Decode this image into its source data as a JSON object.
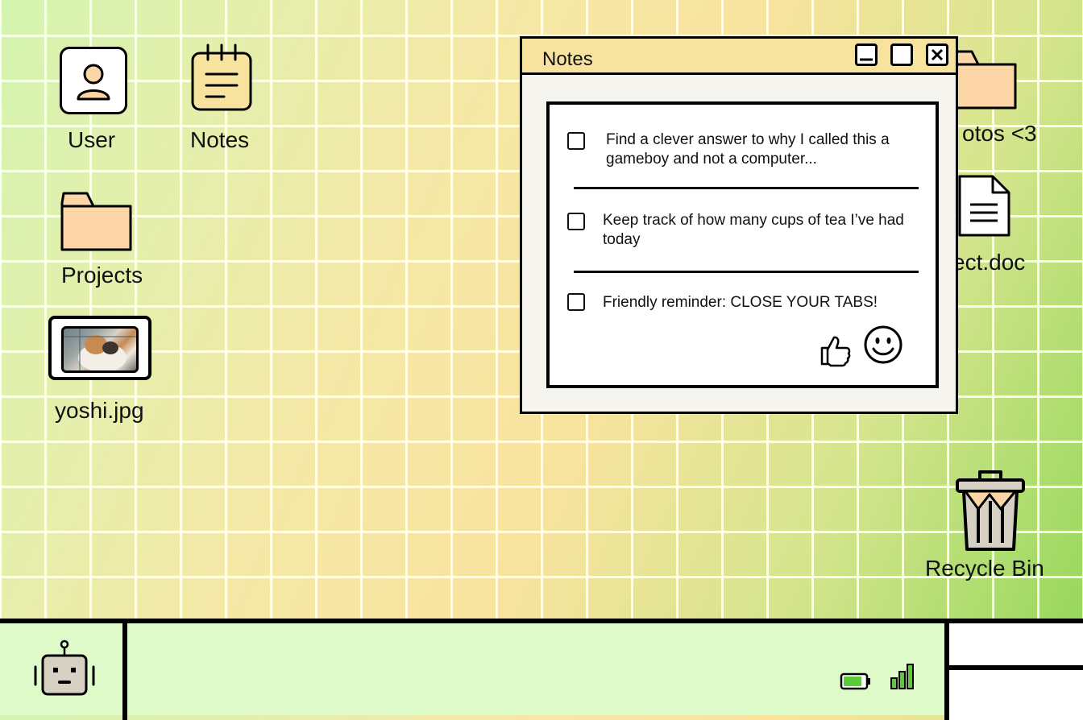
{
  "desktop": {
    "icons": [
      {
        "label": "User",
        "icon": "user-icon"
      },
      {
        "label": "Notes",
        "icon": "notepad-icon"
      },
      {
        "label": "Projects",
        "icon": "folder-icon"
      },
      {
        "label": "yoshi.jpg",
        "icon": "image-file-icon"
      },
      {
        "label": "otos <3",
        "icon": "folder-icon"
      },
      {
        "label": "ect.doc",
        "icon": "document-icon"
      },
      {
        "label": "Recycle Bin",
        "icon": "trash-icon"
      }
    ]
  },
  "notes_window": {
    "title": "Notes",
    "items": [
      {
        "text": "Find a clever answer to why I called this a gameboy and not a computer...",
        "checked": false
      },
      {
        "text": "Keep track of how many cups of tea I’ve had today",
        "checked": false
      },
      {
        "text": "Friendly reminder: CLOSE YOUR TABS!",
        "checked": false
      }
    ]
  },
  "taskbar": {
    "start_icon": "robot-icon",
    "battery_icon": "battery-icon",
    "signal_icon": "signal-icon"
  },
  "colors": {
    "accent_yellow": "#f8e39e",
    "folder_fill": "#fbd5a5",
    "taskbar_bg": "#e0fbca",
    "battery_green": "#5ccb37"
  }
}
